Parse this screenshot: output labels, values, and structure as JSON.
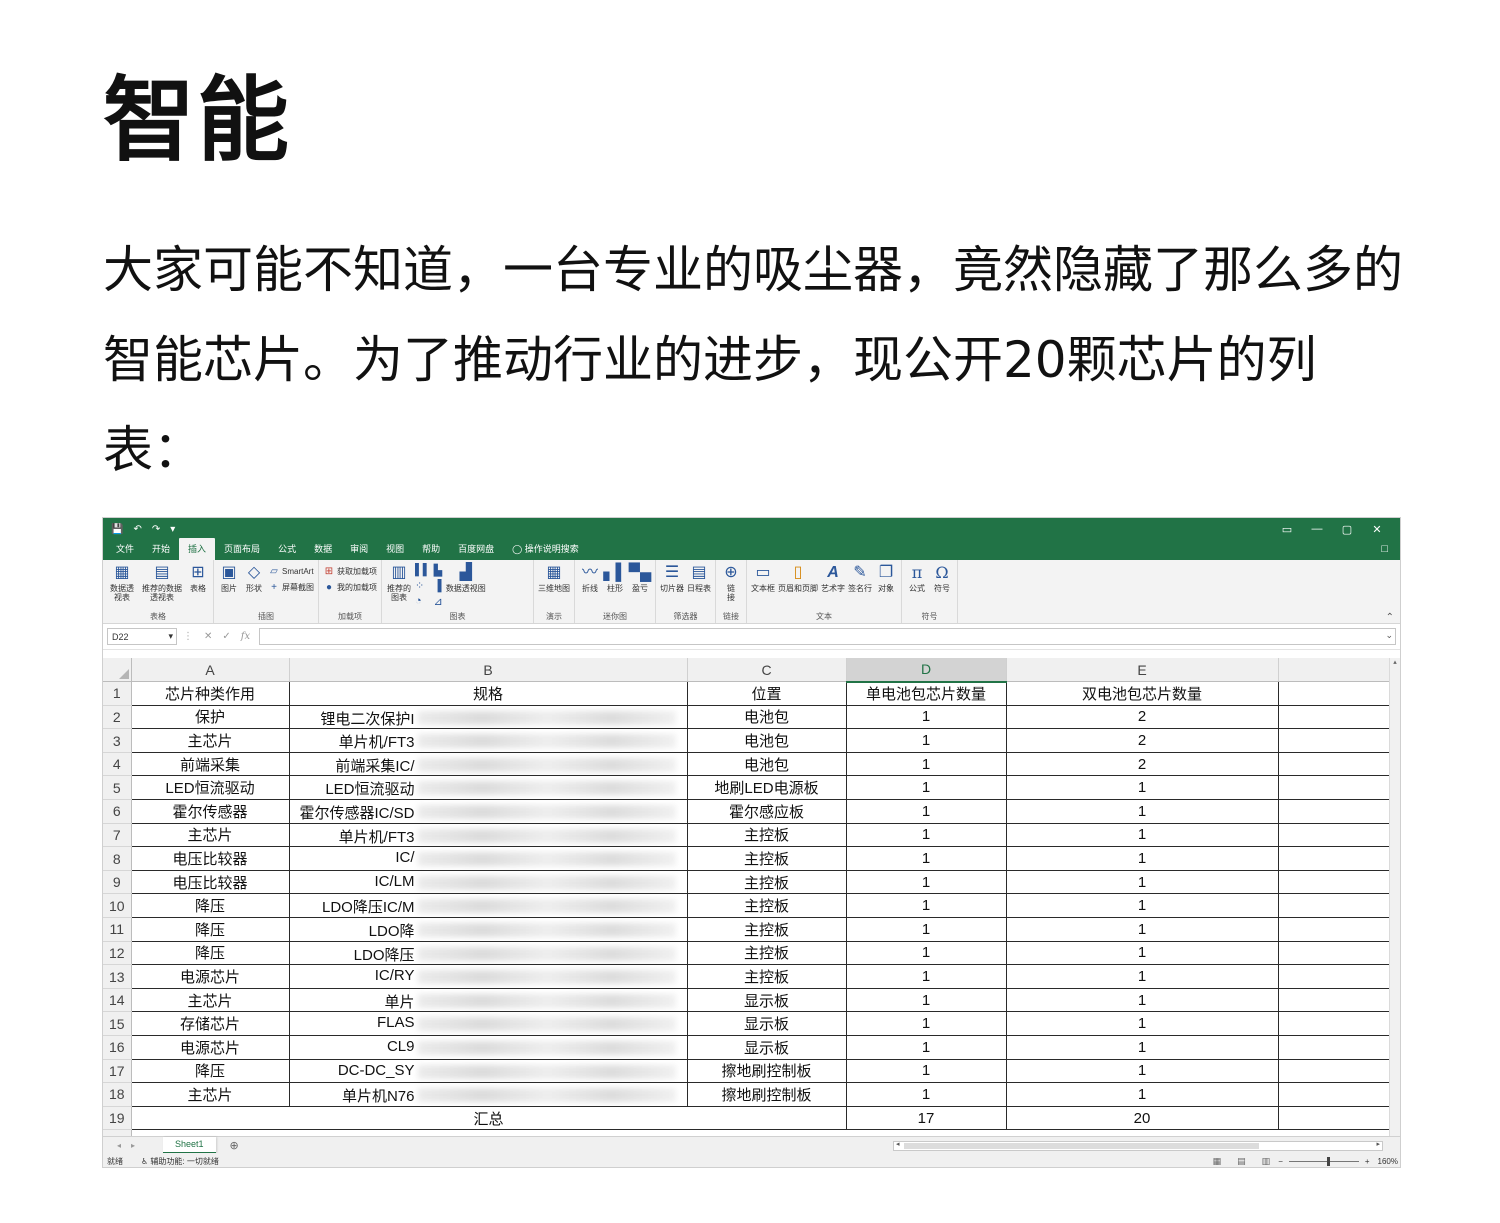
{
  "heading": "智能",
  "intro": "大家可能不知道，一台专业的吸尘器，竟然隐藏了那么多的智能芯片。为了推动行业的进步，现公开20颗芯片的列表：",
  "excel": {
    "accent": "#217346",
    "window_icons": {
      "save": "save-icon",
      "undo": "↶",
      "redo": "↷",
      "ribbon_opts": "▭",
      "minimize": "—",
      "restore": "▢",
      "close": "✕"
    },
    "tabs": [
      "文件",
      "开始",
      "插入",
      "页面布局",
      "公式",
      "数据",
      "审阅",
      "视图",
      "帮助",
      "百度网盘"
    ],
    "active_tab": "插入",
    "tell_me": "操作说明搜索",
    "ribbon": {
      "tables": {
        "label": "表格",
        "pivot": "数据透视表",
        "rec_pivot": "推荐的数据透视表",
        "table": "表格"
      },
      "illustrations": {
        "label": "插图",
        "pictures": "图片",
        "shapes": "形状",
        "smartart": "SmartArt",
        "screenshot": "屏幕截图"
      },
      "addins": {
        "label": "加载项",
        "get": "获取加载项",
        "mine": "我的加载项"
      },
      "charts": {
        "label": "图表",
        "rec": "推荐的图表",
        "pivotchart": "数据透视图"
      },
      "tours": {
        "label": "演示",
        "map3d": "三维地图"
      },
      "spark": {
        "label": "迷你图",
        "line": "折线",
        "column": "柱形",
        "winloss": "盈亏"
      },
      "filters": {
        "label": "筛选器",
        "slicer": "切片器",
        "timeline": "日程表"
      },
      "links": {
        "label": "链接",
        "link": "链接"
      },
      "text": {
        "label": "文本",
        "textbox": "文本框",
        "header": "页眉和页脚",
        "wordart": "艺术字",
        "signature": "签名行",
        "object": "对象"
      },
      "symbols": {
        "label": "符号",
        "equation": "公式",
        "symbol": "符号",
        "pi": "π",
        "omega": "Ω"
      }
    },
    "name_box": "D22",
    "fx": "fx",
    "columns": [
      "A",
      "B",
      "C",
      "D",
      "E"
    ],
    "selected_column": "D",
    "header_row": [
      "芯片种类作用",
      "规格",
      "位置",
      "单电池包芯片数量",
      "双电池包芯片数量"
    ],
    "rows": [
      {
        "a": "保护",
        "b": "锂电二次保护I",
        "c": "电池包",
        "d": "1",
        "e": "2"
      },
      {
        "a": "主芯片",
        "b": "单片机/FT3",
        "c": "电池包",
        "d": "1",
        "e": "2"
      },
      {
        "a": "前端采集",
        "b": "前端采集IC/",
        "c": "电池包",
        "d": "1",
        "e": "2"
      },
      {
        "a": "LED恒流驱动",
        "b": "LED恒流驱动",
        "c": "地刷LED电源板",
        "d": "1",
        "e": "1"
      },
      {
        "a": "霍尔传感器",
        "b": "霍尔传感器IC/SD",
        "c": "霍尔感应板",
        "d": "1",
        "e": "1"
      },
      {
        "a": "主芯片",
        "b": "单片机/FT3",
        "c": "主控板",
        "d": "1",
        "e": "1"
      },
      {
        "a": "电压比较器",
        "b": "IC/",
        "c": "主控板",
        "d": "1",
        "e": "1"
      },
      {
        "a": "电压比较器",
        "b": "IC/LM",
        "c": "主控板",
        "d": "1",
        "e": "1"
      },
      {
        "a": "降压",
        "b": "LDO降压IC/M",
        "c": "主控板",
        "d": "1",
        "e": "1"
      },
      {
        "a": "降压",
        "b": "LDO降",
        "c": "主控板",
        "d": "1",
        "e": "1"
      },
      {
        "a": "降压",
        "b": "LDO降压",
        "c": "主控板",
        "d": "1",
        "e": "1"
      },
      {
        "a": "电源芯片",
        "b": "IC/RY",
        "c": "主控板",
        "d": "1",
        "e": "1"
      },
      {
        "a": "主芯片",
        "b": "单片",
        "c": "显示板",
        "d": "1",
        "e": "1"
      },
      {
        "a": "存储芯片",
        "b": "FLAS",
        "c": "显示板",
        "d": "1",
        "e": "1"
      },
      {
        "a": "电源芯片",
        "b": "CL9",
        "c": "显示板",
        "d": "1",
        "e": "1"
      },
      {
        "a": "降压",
        "b": "DC-DC_SY",
        "c": "擦地刷控制板",
        "d": "1",
        "e": "1"
      },
      {
        "a": "主芯片",
        "b": "单片机N76",
        "c": "擦地刷控制板",
        "d": "1",
        "e": "1"
      }
    ],
    "total_row": {
      "label": "汇总",
      "d": "17",
      "e": "20"
    },
    "sheet_tab": "Sheet1",
    "status_ready": "就绪",
    "accessibility": "辅助功能: 一切就绪",
    "zoom": "160%"
  }
}
